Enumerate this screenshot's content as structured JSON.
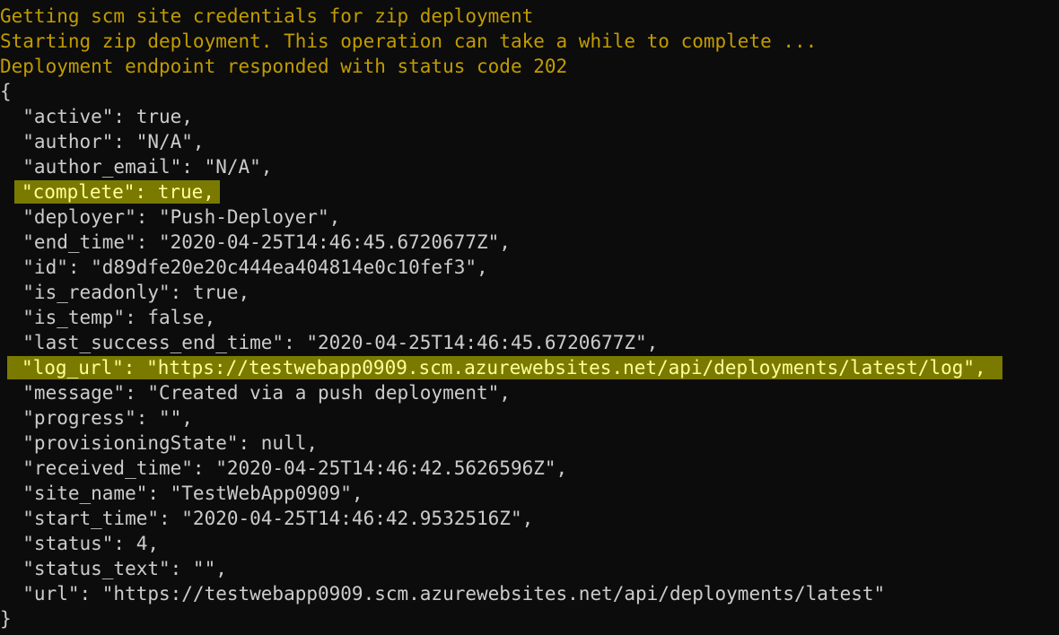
{
  "terminal": {
    "status_lines": [
      "Getting scm site credentials for zip deployment",
      "Starting zip deployment. This operation can take a while to complete ...",
      "Deployment endpoint responded with status code 202"
    ],
    "open_brace": "{",
    "close_brace": "}",
    "json_lines": [
      "  \"active\": true,",
      "  \"author\": \"N/A\",",
      "  \"author_email\": \"N/A\",",
      "\"complete\": true,",
      "  \"deployer\": \"Push-Deployer\",",
      "  \"end_time\": \"2020-04-25T14:46:45.6720677Z\",",
      "  \"id\": \"d89dfe20e20c444ea404814e0c10fef3\",",
      "  \"is_readonly\": true,",
      "  \"is_temp\": false,",
      "  \"last_success_end_time\": \"2020-04-25T14:46:45.6720677Z\",",
      "\"log_url\": \"https://testwebapp0909.scm.azurewebsites.net/api/deployments/latest/log\",",
      "  \"message\": \"Created via a push deployment\",",
      "  \"progress\": \"\",",
      "  \"provisioningState\": null,",
      "  \"received_time\": \"2020-04-25T14:46:42.5626596Z\",",
      "  \"site_name\": \"TestWebApp0909\",",
      "  \"start_time\": \"2020-04-25T14:46:42.9532516Z\",",
      "  \"status\": 4,",
      "  \"status_text\": \"\",",
      "  \"url\": \"https://testwebapp0909.scm.azurewebsites.net/api/deployments/latest\""
    ]
  },
  "colors": {
    "background": "#0c0c0c",
    "foreground": "#cccccc",
    "warning": "#c19c00",
    "highlight_bg": "#7a7a00",
    "highlight_fg": "#ffff9a"
  }
}
